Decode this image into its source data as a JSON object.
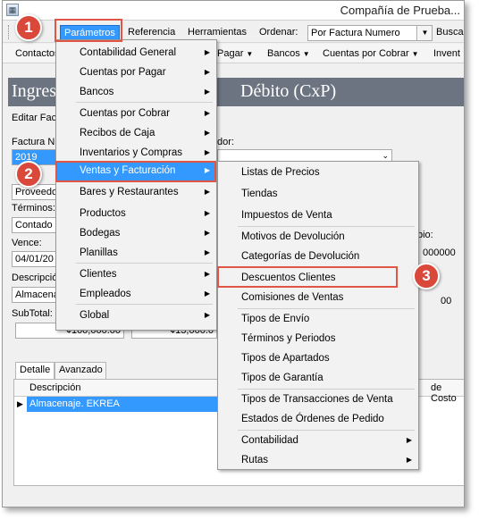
{
  "window": {
    "title": "Compañía de Prueba..."
  },
  "menubar": {
    "items": [
      "Parámetros",
      "Referencia",
      "Herramientas"
    ],
    "ordenar_label": "Ordenar:",
    "ordenar_value": "Por Factura Numero",
    "busca_label": "Busca"
  },
  "toolbar": {
    "items": [
      "Contactos",
      "Pagar",
      "Bancos",
      "Cuentas por Cobrar",
      "Invent"
    ]
  },
  "header": {
    "left": "Ingres",
    "right": "Débito (CxP)"
  },
  "form": {
    "editar": "Editar Factu",
    "factura_label": "Factura N",
    "factura_value": "2019",
    "proveedor_label": "dor:",
    "proveedor_value": "Proveedo",
    "terminos_label": "Términos:",
    "terminos_value": "Contado",
    "vence_label": "Vence:",
    "vence_value": "04/01/20",
    "descripcion_label": "Descripció",
    "descripcion_value": "Almacenaj",
    "subtotal_label": "SubTotal:",
    "subtotal_value": "¢100,000.00",
    "impuesto_value": "¢13,000.0",
    "cambio_label": "bio:",
    "cambio_value": "000000",
    "side_value": "00"
  },
  "tabs": [
    "Detalle",
    "Avanzado"
  ],
  "grid": {
    "col_descripcion": "Descripción",
    "col_costo": "de Costo",
    "row1": "Almacenaje. EKREA"
  },
  "menu_parametros": [
    "Contabilidad General",
    "Cuentas por Pagar",
    "Bancos",
    "Cuentas por Cobrar",
    "Recibos de Caja",
    "Inventarios y Compras",
    "Ventas y Facturación",
    "Bares y Restaurantes",
    "Productos",
    "Bodegas",
    "Planillas",
    "Clientes",
    "Empleados",
    "Global"
  ],
  "menu_ventas": [
    "Listas de Precios",
    "Tiendas",
    "Impuestos de Venta",
    "Motivos de Devolución",
    "Categorías de Devolución",
    "Descuentos Clientes",
    "Comisiones de Ventas",
    "Tipos de Envío",
    "Términos y Periodos",
    "Tipos de Apartados",
    "Tipos de Garantía",
    "Tipos de Transacciones de Venta",
    "Estados de Órdenes de Pedido",
    "Contabilidad",
    "Rutas"
  ],
  "badges": [
    "1",
    "2",
    "3"
  ],
  "colors": {
    "highlight": "#3399ff",
    "callout": "#e05545",
    "badge": "#d9483b"
  }
}
